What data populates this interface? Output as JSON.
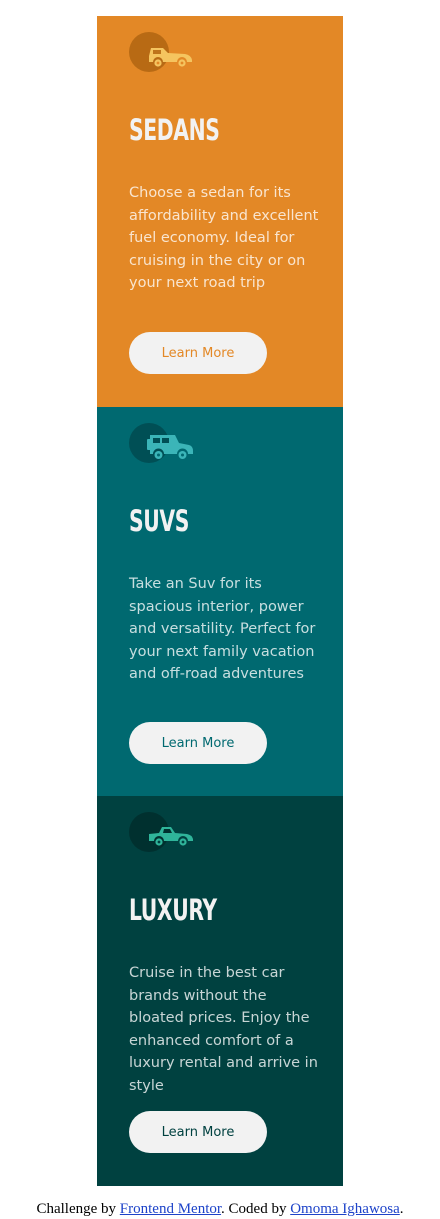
{
  "cards": [
    {
      "title": "Sedans",
      "description": "Choose a sedan for its affordability and excellent fuel economy. Ideal for cruising in the city or on your next road trip",
      "button_label": "Learn More",
      "icon": "sedan-car-icon",
      "background": "#e38826",
      "accent": "#e38826",
      "icon_color": "#f5c45f",
      "icon_circle": "#b86a14"
    },
    {
      "title": "Suvs",
      "description": "Take an Suv for its spacious interior, power and versatility. Perfect for your next family vacation and off-road adventures",
      "button_label": "Learn More",
      "icon": "suv-car-icon",
      "background": "#006970",
      "accent": "#006970",
      "icon_color": "#3bb5b8",
      "icon_circle": "#004f55"
    },
    {
      "title": "Luxury",
      "description": "Cruise in the best car brands without the bloated prices. Enjoy the enhanced comfort of a luxury rental and arrive in style",
      "button_label": "Learn More",
      "icon": "luxury-car-icon",
      "background": "#004140",
      "accent": "#004140",
      "icon_color": "#2fb49a",
      "icon_circle": "#00302f"
    }
  ],
  "footer": {
    "prefix": "Challenge by ",
    "link1": "Frontend Mentor",
    "middle": ". Coded by ",
    "link2": "Omoma Ighawosa",
    "suffix": "."
  }
}
